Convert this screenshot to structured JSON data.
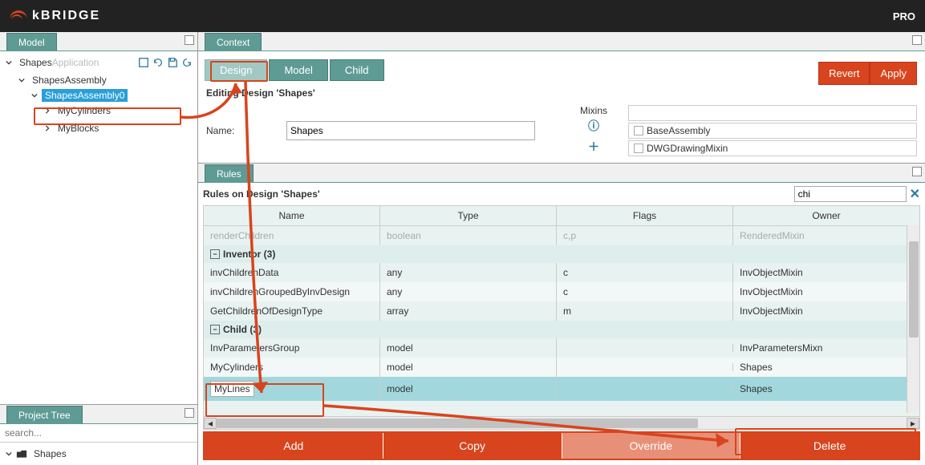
{
  "brand": "kBRIDGE",
  "topbarRight": "PRO",
  "panels": {
    "model": {
      "tab": "Model"
    },
    "context": {
      "tab": "Context"
    },
    "projectTree": {
      "tab": "Project Tree"
    },
    "rules": {
      "tab": "Rules"
    }
  },
  "modelTree": {
    "root": "Shapes",
    "rootSuffix": "Application",
    "children": [
      {
        "label": "ShapesAssembly",
        "children": [
          {
            "label": "ShapesAssembly0",
            "selected": true,
            "children": [
              {
                "label": "MyCylinders"
              },
              {
                "label": "MyBlocks"
              }
            ]
          }
        ]
      }
    ]
  },
  "projectSearchPlaceholder": "search...",
  "projectList": [
    {
      "label": "Shapes"
    }
  ],
  "subtabs": [
    {
      "label": "Design",
      "active": true
    },
    {
      "label": "Model"
    },
    {
      "label": "Child"
    }
  ],
  "editing": {
    "heading": "Editing Design 'Shapes'",
    "nameLabel": "Name:",
    "nameValue": "Shapes",
    "mixinsLabel": "Mixins",
    "mixins": [
      "BaseAssembly",
      "DWGDrawingMixin"
    ],
    "revert": "Revert",
    "apply": "Apply"
  },
  "rules": {
    "heading": "Rules on Design 'Shapes'",
    "search": "chi",
    "columns": {
      "name": "Name",
      "type": "Type",
      "flags": "Flags",
      "owner": "Owner"
    },
    "fadedRow": {
      "name": "renderChildren",
      "type": "boolean",
      "flags": "c,p",
      "owner": "RenderedMixin"
    },
    "groups": [
      {
        "title": "Inventor (3)",
        "rows": [
          {
            "name": "invChildrenData",
            "type": "any",
            "flags": "c",
            "owner": "InvObjectMixin"
          },
          {
            "name": "invChildrenGroupedByInvDesign",
            "type": "any",
            "flags": "c",
            "owner": "InvObjectMixin"
          },
          {
            "name": "GetChildrenOfDesignType",
            "type": "array",
            "flags": "m",
            "owner": "InvObjectMixin"
          }
        ]
      },
      {
        "title": "Child (3)",
        "rows": [
          {
            "name": "InvParametersGroup",
            "type": "model",
            "flags": "",
            "owner": "InvParametersMixn"
          },
          {
            "name": "MyCylinders",
            "type": "model",
            "flags": "",
            "owner": "Shapes"
          },
          {
            "name": "MyLines",
            "type": "model",
            "flags": "",
            "owner": "Shapes",
            "selected": true,
            "editing": true
          }
        ]
      }
    ]
  },
  "actions": {
    "add": "Add",
    "copy": "Copy",
    "override": "Override",
    "delete": "Delete"
  }
}
